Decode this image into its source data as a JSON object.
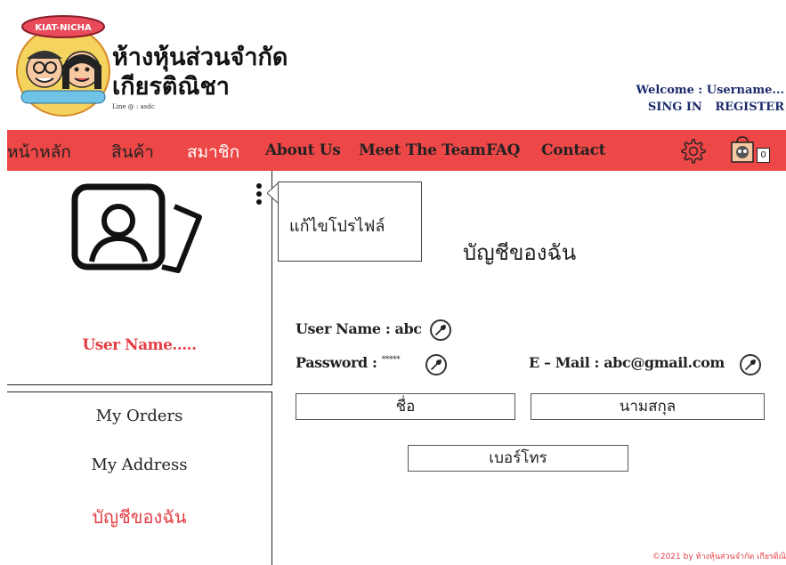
{
  "brand": {
    "name_line1": "ห้างหุ้นส่วนจำกัด",
    "name_line2": "เกียรติณิชา",
    "line_id": "Line @ : asdc",
    "logo_text": "KIAT-NICHA"
  },
  "header": {
    "welcome": "Welcome : Username...",
    "sign_in": "SING IN",
    "register": "REGISTER"
  },
  "nav": {
    "items": [
      "หน้าหลัก",
      "สินค้า",
      "สมาชิก",
      "About Us",
      "Meet The Team",
      "FAQ",
      "Contact"
    ],
    "active": "สมาชิก",
    "cart_count": "0"
  },
  "sidebar": {
    "user_name": "User Name.....",
    "menu": [
      "My Orders",
      "My Address",
      "บัญชีของฉัน"
    ]
  },
  "popover": {
    "edit_profile": "แก้ไขโปรไฟล์"
  },
  "main": {
    "title": "บัญชีของฉัน",
    "username_label": "User Name : abc",
    "password_label": "Password  :",
    "password_value": "*****",
    "email_label": "E – Mail : abc@gmail.com",
    "first_name": "ชื่อ",
    "last_name": "นามสกุล",
    "phone": "เบอร์โทร"
  },
  "footer": {
    "copyright": "©2021 by ห้างหุ้นส่วนจำกัด เกียรติณิ"
  },
  "colors": {
    "accent": "#ee4747",
    "accent_text": "#e33f45",
    "header_link": "#1d2b6b"
  }
}
